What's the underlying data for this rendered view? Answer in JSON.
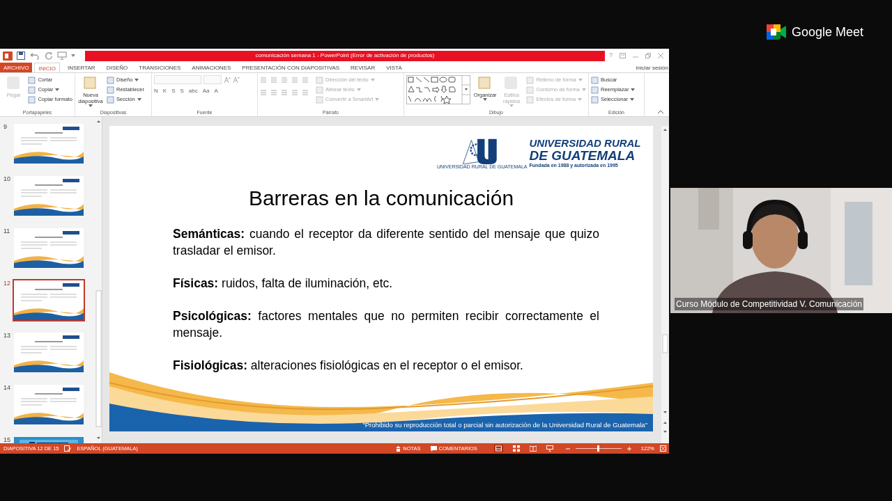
{
  "meet": {
    "brand": "Google Meet"
  },
  "window": {
    "title": "comunicación semana 1 - PowerPoint (Error de activación de productos)",
    "help": "?"
  },
  "ribbon_tabs": [
    {
      "label": "ARCHIVO",
      "kind": "file",
      "selected": false
    },
    {
      "label": "INICIO",
      "kind": "tab",
      "selected": true
    },
    {
      "label": "INSERTAR",
      "kind": "tab",
      "selected": false
    },
    {
      "label": "DISEÑO",
      "kind": "tab",
      "selected": false
    },
    {
      "label": "TRANSICIONES",
      "kind": "tab",
      "selected": false
    },
    {
      "label": "ANIMACIONES",
      "kind": "tab",
      "selected": false
    },
    {
      "label": "PRESENTACIÓN CON DIAPOSITIVAS",
      "kind": "tab",
      "selected": false
    },
    {
      "label": "REVISAR",
      "kind": "tab",
      "selected": false
    },
    {
      "label": "VISTA",
      "kind": "tab",
      "selected": false
    }
  ],
  "account": {
    "label": "Iniciar sesión"
  },
  "ribbon_groups": [
    {
      "name": "Portapapeles",
      "kind": "standard",
      "items": [
        {
          "label": "Pegar",
          "kind": "large",
          "disabled": true,
          "dropdown": false
        },
        {
          "label": "Cortar",
          "kind": "small",
          "disabled": false,
          "dropdown": false
        },
        {
          "label": "Copiar",
          "kind": "small",
          "disabled": false,
          "dropdown": true
        },
        {
          "label": "Copiar formato",
          "kind": "small",
          "disabled": false,
          "dropdown": false
        }
      ]
    },
    {
      "name": "Diapositivas",
      "kind": "standard",
      "items": [
        {
          "label": "Nueva diapositiva",
          "kind": "large",
          "disabled": false,
          "dropdown": true
        },
        {
          "label": "Diseño",
          "kind": "small",
          "disabled": false,
          "dropdown": true
        },
        {
          "label": "Restablecer",
          "kind": "small",
          "disabled": false,
          "dropdown": false
        },
        {
          "label": "Sección",
          "kind": "small",
          "disabled": false,
          "dropdown": true
        }
      ]
    },
    {
      "name": "Fuente",
      "kind": "font",
      "buttons": [
        "N",
        "K",
        "S",
        "S",
        "abc",
        "Aa",
        "A"
      ]
    },
    {
      "name": "Párrafo",
      "kind": "paragraph",
      "items": [
        {
          "label": "Dirección del texto",
          "kind": "small",
          "disabled": true,
          "dropdown": true
        },
        {
          "label": "Alinear texto",
          "kind": "small",
          "disabled": true,
          "dropdown": true
        },
        {
          "label": "Convertir a SmartArt",
          "kind": "small",
          "disabled": true,
          "dropdown": true
        }
      ]
    },
    {
      "name": "Dibujo",
      "kind": "drawing",
      "items": [
        {
          "label": "Organizar",
          "kind": "large",
          "disabled": false,
          "dropdown": true
        },
        {
          "label": "Estilos rápidos",
          "kind": "large",
          "disabled": true,
          "dropdown": true
        },
        {
          "label": "Relleno de forma",
          "kind": "small",
          "disabled": true,
          "dropdown": true
        },
        {
          "label": "Contorno de forma",
          "kind": "small",
          "disabled": true,
          "dropdown": true
        },
        {
          "label": "Efectos de forma",
          "kind": "small",
          "disabled": true,
          "dropdown": true
        }
      ]
    },
    {
      "name": "Edición",
      "kind": "standard",
      "items": [
        {
          "label": "Buscar",
          "kind": "small",
          "disabled": false,
          "dropdown": false
        },
        {
          "label": "Reemplazar",
          "kind": "small",
          "disabled": false,
          "dropdown": true
        },
        {
          "label": "Seleccionar",
          "kind": "small",
          "disabled": false,
          "dropdown": true
        }
      ]
    }
  ],
  "thumbnails": [
    {
      "number": "9",
      "kind": "content",
      "selected": false
    },
    {
      "number": "10",
      "kind": "content",
      "selected": false
    },
    {
      "number": "11",
      "kind": "content",
      "selected": false
    },
    {
      "number": "12",
      "kind": "content",
      "selected": true
    },
    {
      "number": "13",
      "kind": "content",
      "selected": false
    },
    {
      "number": "14",
      "kind": "content",
      "selected": false
    },
    {
      "number": "15",
      "kind": "closing",
      "selected": false
    }
  ],
  "slide": {
    "logo": {
      "line1": "UNIVERSIDAD RURAL",
      "line2": "DE GUATEMALA",
      "tagline": "Fundada en 1988 y autorizada en 1995",
      "small": "UNIVERSIDAD RURAL DE GUATEMALA"
    },
    "title": "Barreras en la comunicación",
    "paragraphs": [
      "**Semánticas:** cuando el receptor da diferente sentido del mensaje que quizo trasladar el emisor.",
      "**Físicas:** ruidos, falta de iluminación, etc.",
      "**Psicológicas:** factores mentales que no permiten recibir correctamente el mensaje.",
      "**Fisiológicas:** alteraciones fisiológicas en el receptor o el emisor."
    ],
    "footer": "\"Prohibido su reproducción total o parcial sin autorización de la Universidad Rural de Guatemala\""
  },
  "status_bar": {
    "slide": "DIAPOSITIVA 12 DE 15",
    "language": "ESPAÑOL (GUATEMALA)",
    "notes": "NOTAS",
    "comments": "COMENTARIOS",
    "zoom": "122%",
    "zoom_slider": {
      "level": 0.5
    }
  },
  "participant": {
    "caption": "Curso Módulo de Competitividad V. Comunicación"
  }
}
